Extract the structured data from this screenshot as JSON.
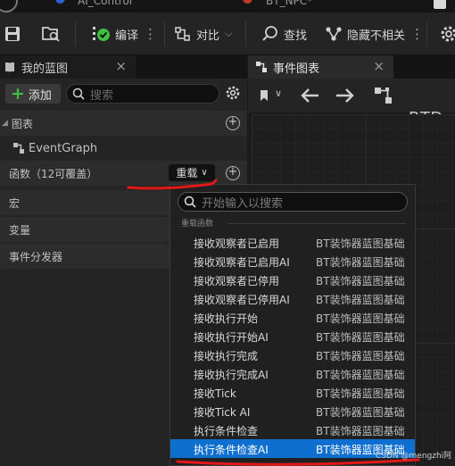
{
  "window_tabs": [
    {
      "label": "AI_Control",
      "color": "#2f5fd0"
    },
    {
      "label": "BT_NPC*",
      "color": "#c0392b"
    }
  ],
  "toolbar": {
    "compile_label": "编译",
    "diff_label": "对比",
    "find_label": "查找",
    "hide_unrelated_label": "隐藏不相关"
  },
  "my_blueprint": {
    "tab_title": "我的蓝图",
    "add_label": "添加",
    "search_placeholder": "搜索",
    "graphs_header": "图表",
    "event_graph": "EventGraph",
    "functions_header": "函数（12可覆盖）",
    "override_label": "重载",
    "macros_header": "宏",
    "variables_header": "变量",
    "event_dispatchers_header": "事件分发器"
  },
  "event_graph_panel": {
    "tab_title": "事件图表",
    "breadcrumb": "BTDec"
  },
  "override_menu": {
    "search_placeholder": "开始输入以搜索",
    "section_label": "重载函数",
    "items": [
      {
        "name": "接收观察者已启用",
        "category": "BT装饰器蓝图基础"
      },
      {
        "name": "接收观察者已启用AI",
        "category": "BT装饰器蓝图基础"
      },
      {
        "name": "接收观察者已停用",
        "category": "BT装饰器蓝图基础"
      },
      {
        "name": "接收观察者已停用AI",
        "category": "BT装饰器蓝图基础"
      },
      {
        "name": "接收执行开始",
        "category": "BT装饰器蓝图基础"
      },
      {
        "name": "接收执行开始AI",
        "category": "BT装饰器蓝图基础"
      },
      {
        "name": "接收执行完成",
        "category": "BT装饰器蓝图基础"
      },
      {
        "name": "接收执行完成AI",
        "category": "BT装饰器蓝图基础"
      },
      {
        "name": "接收Tick",
        "category": "BT装饰器蓝图基础"
      },
      {
        "name": "接收Tick AI",
        "category": "BT装饰器蓝图基础"
      },
      {
        "name": "执行条件检查",
        "category": "BT装饰器蓝图基础"
      },
      {
        "name": "执行条件检查AI",
        "category": "BT装饰器蓝图基础"
      }
    ],
    "selected_index": 11
  },
  "watermark": "CSDN @mengzhi阿",
  "colors": {
    "accent_selected": "#0f6fcf",
    "add_plus": "#3fbf3f",
    "annotation_red": "#e01818"
  }
}
